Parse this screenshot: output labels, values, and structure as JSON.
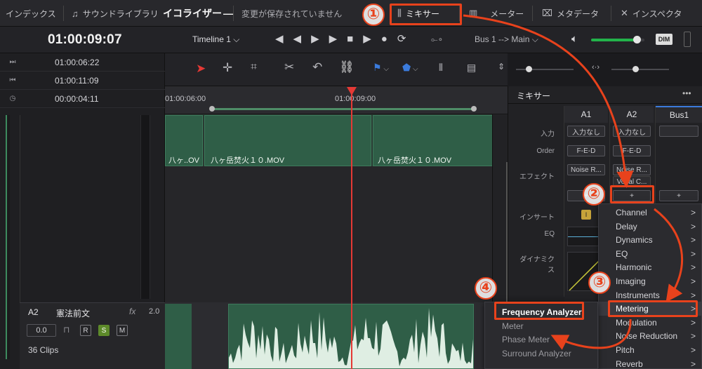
{
  "top_bar": {
    "index_label": "インデックス",
    "sound_library_label": "サウンドライブラリ",
    "overlap_title": "イコライザー",
    "unsaved_status": "変更が保存されていません",
    "mixer_label": "ミキサー",
    "meter_label": "メーター",
    "metadata_label": "メタデータ",
    "inspector_label": "インスペクタ"
  },
  "transport": {
    "timecode": "01:00:09:07",
    "timeline_name": "Timeline 1",
    "bus_label": "Bus 1",
    "bus_arrow": "-->",
    "main_label": "Main",
    "dim_label": "DIM",
    "volume_level": 0.85
  },
  "timecodes": [
    {
      "icon": "mark-in-icon",
      "glyph": "⏭",
      "value": "01:00:06:22"
    },
    {
      "icon": "mark-out-icon",
      "glyph": "⏮",
      "value": "01:00:11:09"
    },
    {
      "icon": "clock-icon",
      "glyph": "◷",
      "value": "00:00:04:11"
    }
  ],
  "ruler": {
    "tc1": "01:00:06:00",
    "tc2": "01:00:09:00"
  },
  "clips": {
    "clip1": "八ヶ..OV",
    "clip2": "八ヶ岳焚火１０.MOV",
    "clip3": "八ヶ岳焚火１０.MOV"
  },
  "track_a2": {
    "id": "A2",
    "name": "憲法前文",
    "fx": "fx",
    "volume": "2.0",
    "level": "0.0",
    "r": "R",
    "s": "S",
    "m": "M",
    "clips": "36 Clips"
  },
  "mixer": {
    "title": "ミキサー",
    "more": "•••",
    "columns": [
      "A1",
      "A2",
      "Bus1"
    ],
    "row_input": "入力",
    "input_a1": "入力なし",
    "input_a2": "入力なし",
    "row_order": "Order",
    "order_a1": "F-E-D",
    "order_a2": "F-E-D",
    "row_effect": "エフェクト",
    "effect_a1": "Noise R...",
    "effect_a2": "Noise R...",
    "effect_a2b": "Vocal C...",
    "add_a1": "+",
    "add_a2": "+",
    "add_bus1": "+",
    "row_insert": "インサート",
    "insert_badge": "I",
    "row_eq": "EQ",
    "row_dynamics": "ダイナミクス"
  },
  "menu_main": {
    "items": [
      {
        "label": "Channel",
        "arrow": ">"
      },
      {
        "label": "Delay",
        "arrow": ">"
      },
      {
        "label": "Dynamics",
        "arrow": ">"
      },
      {
        "label": "EQ",
        "arrow": ">"
      },
      {
        "label": "Harmonic",
        "arrow": ">"
      },
      {
        "label": "Imaging",
        "arrow": ">"
      },
      {
        "label": "Instruments",
        "arrow": ">"
      },
      {
        "label": "Metering",
        "arrow": ">"
      },
      {
        "label": "Modulation",
        "arrow": ">"
      },
      {
        "label": "Noise Reduction",
        "arrow": ">"
      },
      {
        "label": "Pitch",
        "arrow": ">"
      },
      {
        "label": "Reverb",
        "arrow": ">"
      }
    ]
  },
  "menu_metering": {
    "items": [
      "Frequency Analyzer",
      "Meter",
      "Phase Meter",
      "Surround Analyzer"
    ]
  },
  "annotations": {
    "n1": "①",
    "n2": "②",
    "n3": "③",
    "n4": "④"
  },
  "colors": {
    "accent": "#e8421c",
    "clip_green": "#2f5e47",
    "playhead": "#e53935"
  }
}
